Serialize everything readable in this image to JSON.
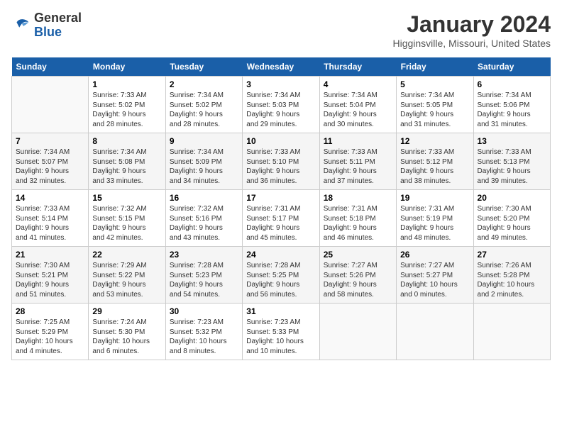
{
  "logo": {
    "general": "General",
    "blue": "Blue"
  },
  "title": "January 2024",
  "location": "Higginsville, Missouri, United States",
  "days_of_week": [
    "Sunday",
    "Monday",
    "Tuesday",
    "Wednesday",
    "Thursday",
    "Friday",
    "Saturday"
  ],
  "weeks": [
    [
      {
        "day": "",
        "info": ""
      },
      {
        "day": "1",
        "info": "Sunrise: 7:33 AM\nSunset: 5:02 PM\nDaylight: 9 hours\nand 28 minutes."
      },
      {
        "day": "2",
        "info": "Sunrise: 7:34 AM\nSunset: 5:02 PM\nDaylight: 9 hours\nand 28 minutes."
      },
      {
        "day": "3",
        "info": "Sunrise: 7:34 AM\nSunset: 5:03 PM\nDaylight: 9 hours\nand 29 minutes."
      },
      {
        "day": "4",
        "info": "Sunrise: 7:34 AM\nSunset: 5:04 PM\nDaylight: 9 hours\nand 30 minutes."
      },
      {
        "day": "5",
        "info": "Sunrise: 7:34 AM\nSunset: 5:05 PM\nDaylight: 9 hours\nand 31 minutes."
      },
      {
        "day": "6",
        "info": "Sunrise: 7:34 AM\nSunset: 5:06 PM\nDaylight: 9 hours\nand 31 minutes."
      }
    ],
    [
      {
        "day": "7",
        "info": "Sunrise: 7:34 AM\nSunset: 5:07 PM\nDaylight: 9 hours\nand 32 minutes."
      },
      {
        "day": "8",
        "info": "Sunrise: 7:34 AM\nSunset: 5:08 PM\nDaylight: 9 hours\nand 33 minutes."
      },
      {
        "day": "9",
        "info": "Sunrise: 7:34 AM\nSunset: 5:09 PM\nDaylight: 9 hours\nand 34 minutes."
      },
      {
        "day": "10",
        "info": "Sunrise: 7:33 AM\nSunset: 5:10 PM\nDaylight: 9 hours\nand 36 minutes."
      },
      {
        "day": "11",
        "info": "Sunrise: 7:33 AM\nSunset: 5:11 PM\nDaylight: 9 hours\nand 37 minutes."
      },
      {
        "day": "12",
        "info": "Sunrise: 7:33 AM\nSunset: 5:12 PM\nDaylight: 9 hours\nand 38 minutes."
      },
      {
        "day": "13",
        "info": "Sunrise: 7:33 AM\nSunset: 5:13 PM\nDaylight: 9 hours\nand 39 minutes."
      }
    ],
    [
      {
        "day": "14",
        "info": "Sunrise: 7:33 AM\nSunset: 5:14 PM\nDaylight: 9 hours\nand 41 minutes."
      },
      {
        "day": "15",
        "info": "Sunrise: 7:32 AM\nSunset: 5:15 PM\nDaylight: 9 hours\nand 42 minutes."
      },
      {
        "day": "16",
        "info": "Sunrise: 7:32 AM\nSunset: 5:16 PM\nDaylight: 9 hours\nand 43 minutes."
      },
      {
        "day": "17",
        "info": "Sunrise: 7:31 AM\nSunset: 5:17 PM\nDaylight: 9 hours\nand 45 minutes."
      },
      {
        "day": "18",
        "info": "Sunrise: 7:31 AM\nSunset: 5:18 PM\nDaylight: 9 hours\nand 46 minutes."
      },
      {
        "day": "19",
        "info": "Sunrise: 7:31 AM\nSunset: 5:19 PM\nDaylight: 9 hours\nand 48 minutes."
      },
      {
        "day": "20",
        "info": "Sunrise: 7:30 AM\nSunset: 5:20 PM\nDaylight: 9 hours\nand 49 minutes."
      }
    ],
    [
      {
        "day": "21",
        "info": "Sunrise: 7:30 AM\nSunset: 5:21 PM\nDaylight: 9 hours\nand 51 minutes."
      },
      {
        "day": "22",
        "info": "Sunrise: 7:29 AM\nSunset: 5:22 PM\nDaylight: 9 hours\nand 53 minutes."
      },
      {
        "day": "23",
        "info": "Sunrise: 7:28 AM\nSunset: 5:23 PM\nDaylight: 9 hours\nand 54 minutes."
      },
      {
        "day": "24",
        "info": "Sunrise: 7:28 AM\nSunset: 5:25 PM\nDaylight: 9 hours\nand 56 minutes."
      },
      {
        "day": "25",
        "info": "Sunrise: 7:27 AM\nSunset: 5:26 PM\nDaylight: 9 hours\nand 58 minutes."
      },
      {
        "day": "26",
        "info": "Sunrise: 7:27 AM\nSunset: 5:27 PM\nDaylight: 10 hours\nand 0 minutes."
      },
      {
        "day": "27",
        "info": "Sunrise: 7:26 AM\nSunset: 5:28 PM\nDaylight: 10 hours\nand 2 minutes."
      }
    ],
    [
      {
        "day": "28",
        "info": "Sunrise: 7:25 AM\nSunset: 5:29 PM\nDaylight: 10 hours\nand 4 minutes."
      },
      {
        "day": "29",
        "info": "Sunrise: 7:24 AM\nSunset: 5:30 PM\nDaylight: 10 hours\nand 6 minutes."
      },
      {
        "day": "30",
        "info": "Sunrise: 7:23 AM\nSunset: 5:32 PM\nDaylight: 10 hours\nand 8 minutes."
      },
      {
        "day": "31",
        "info": "Sunrise: 7:23 AM\nSunset: 5:33 PM\nDaylight: 10 hours\nand 10 minutes."
      },
      {
        "day": "",
        "info": ""
      },
      {
        "day": "",
        "info": ""
      },
      {
        "day": "",
        "info": ""
      }
    ]
  ]
}
